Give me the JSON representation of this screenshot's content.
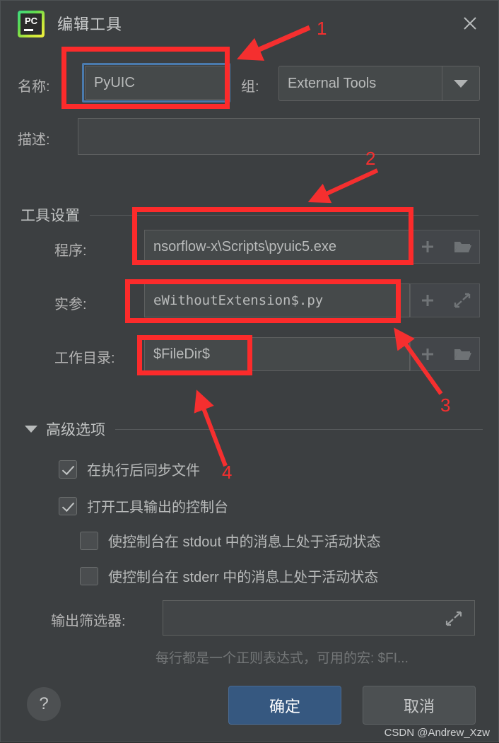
{
  "window": {
    "title": "编辑工具",
    "app_icon": "pycharm-icon",
    "app_icon_text": "PC",
    "close_icon": "close-icon"
  },
  "form": {
    "name_label": "名称:",
    "name_value": "PyUIC",
    "group_label": "组:",
    "group_value": "External Tools",
    "group_options": [
      "External Tools"
    ],
    "description_label": "描述:",
    "description_value": ""
  },
  "tool_settings": {
    "section_label": "工具设置",
    "program_label": "程序:",
    "program_value": "nsorflow-x\\Scripts\\pyuic5.exe",
    "program_add_icon": "plus-icon",
    "program_browse_icon": "folder-icon",
    "arguments_label": "实参:",
    "arguments_value": "eWithoutExtension$.py",
    "arguments_add_icon": "plus-icon",
    "arguments_expand_icon": "expand-icon",
    "workdir_label": "工作目录:",
    "workdir_value": "$FileDir$",
    "workdir_add_icon": "plus-icon",
    "workdir_browse_icon": "folder-icon"
  },
  "advanced": {
    "section_label": "高级选项",
    "collapse_icon": "chevron-down-icon",
    "options": [
      {
        "label": "在执行后同步文件",
        "checked": true
      },
      {
        "label": "打开工具输出的控制台",
        "checked": true
      },
      {
        "label": "使控制台在 stdout 中的消息上处于活动状态",
        "checked": false
      },
      {
        "label": "使控制台在 stderr 中的消息上处于活动状态",
        "checked": false
      }
    ],
    "output_filter_label": "输出筛选器:",
    "output_filter_value": "",
    "output_filter_expand_icon": "expand-icon",
    "hint": "每行都是一个正则表达式，可用的宏: $FI..."
  },
  "footer": {
    "help_label": "?",
    "ok_label": "确定",
    "cancel_label": "取消"
  },
  "annotations": {
    "numbers": [
      "1",
      "2",
      "3",
      "4"
    ],
    "color": "#f52f2f"
  },
  "watermark": "CSDN @Andrew_Xzw"
}
